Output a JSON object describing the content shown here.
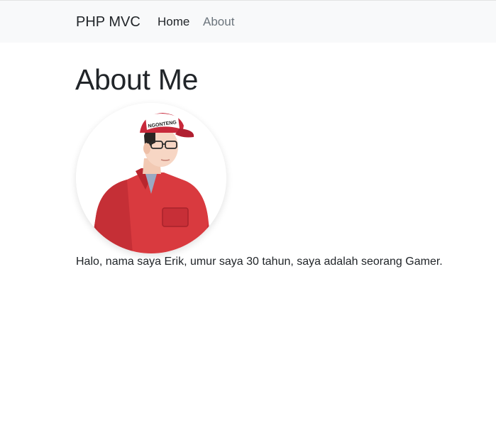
{
  "navbar": {
    "brand": "PHP MVC",
    "links": [
      {
        "label": "Home",
        "active": true
      },
      {
        "label": "About",
        "active": false
      }
    ],
    "background": "#f8f9fa"
  },
  "main": {
    "title": "About Me",
    "avatar": {
      "icon": "profile-photo-avatar",
      "cap_text": "NGONTENG"
    },
    "bio": "Halo, nama saya Erik, umur saya 30 tahun, saya adalah seorang Gamer."
  },
  "colors": {
    "text": "#212529",
    "muted": "#6c757d",
    "shirt": "#d93a3f",
    "cap": "#c8283a"
  }
}
